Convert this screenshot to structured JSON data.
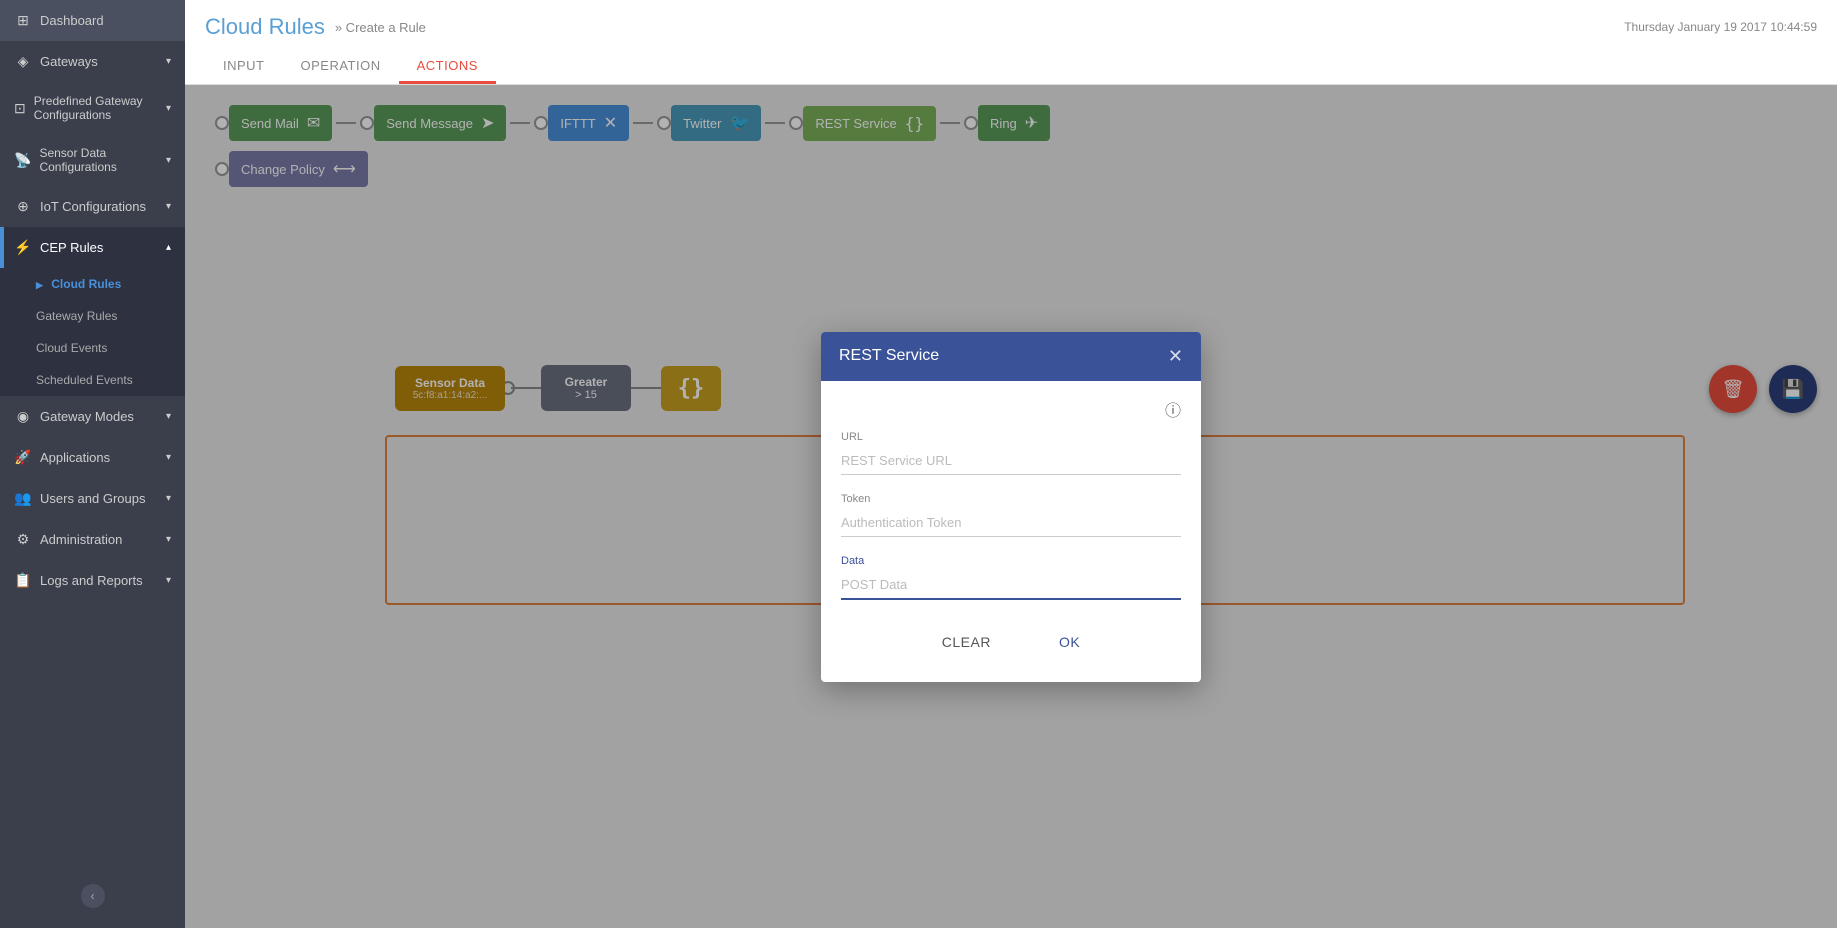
{
  "sidebar": {
    "items": [
      {
        "id": "dashboard",
        "label": "Dashboard",
        "icon": "⊞",
        "hasChevron": false,
        "active": false
      },
      {
        "id": "gateways",
        "label": "Gateways",
        "icon": "◈",
        "hasChevron": true,
        "active": false
      },
      {
        "id": "predefined-gateway",
        "label": "Predefined Gateway Configurations",
        "icon": "⊡",
        "hasChevron": true,
        "active": false
      },
      {
        "id": "sensor-data",
        "label": "Sensor Data Configurations",
        "icon": "📡",
        "hasChevron": true,
        "active": false
      },
      {
        "id": "iot-configurations",
        "label": "IoT Configurations",
        "icon": "⊕",
        "hasChevron": true,
        "active": false
      },
      {
        "id": "cep-rules",
        "label": "CEP Rules",
        "icon": "⚡",
        "hasChevron": true,
        "active": true
      },
      {
        "id": "gateway-modes",
        "label": "Gateway Modes",
        "icon": "◉",
        "hasChevron": true,
        "active": false
      },
      {
        "id": "applications",
        "label": "Applications",
        "icon": "🚀",
        "hasChevron": true,
        "active": false
      },
      {
        "id": "users-and-groups",
        "label": "Users and Groups",
        "icon": "👥",
        "hasChevron": true,
        "active": false
      },
      {
        "id": "administration",
        "label": "Administration",
        "icon": "⚙",
        "hasChevron": true,
        "active": false
      },
      {
        "id": "logs-and-reports",
        "label": "Logs and Reports",
        "icon": "📋",
        "hasChevron": true,
        "active": false
      }
    ],
    "subItems": [
      {
        "label": "Cloud Rules",
        "active": true
      },
      {
        "label": "Gateway Rules",
        "active": false
      },
      {
        "label": "Cloud Events",
        "active": false
      },
      {
        "label": "Scheduled Events",
        "active": false
      }
    ]
  },
  "header": {
    "title": "Cloud Rules",
    "breadcrumb": "» Create a Rule",
    "timestamp": "Thursday January 19 2017 10:44:59"
  },
  "tabs": [
    {
      "id": "input",
      "label": "INPUT",
      "active": false
    },
    {
      "id": "operation",
      "label": "OPERATION",
      "active": false
    },
    {
      "id": "actions",
      "label": "ACTIONS",
      "active": true
    }
  ],
  "actionNodes": [
    {
      "id": "send-mail",
      "label": "Send Mail",
      "icon": "✉",
      "colorClass": "node-send-mail"
    },
    {
      "id": "send-message",
      "label": "Send Message",
      "icon": "➤",
      "colorClass": "node-send-message"
    },
    {
      "id": "ifttt",
      "label": "IFTTT",
      "icon": "✕",
      "colorClass": "node-ifttt"
    },
    {
      "id": "twitter",
      "label": "Twitter",
      "icon": "🐦",
      "colorClass": "node-twitter"
    },
    {
      "id": "rest-service",
      "label": "REST Service",
      "icon": "{}",
      "colorClass": "node-rest-service"
    },
    {
      "id": "ring",
      "label": "Ring",
      "icon": "✈",
      "colorClass": "node-ring"
    },
    {
      "id": "change-policy",
      "label": "Change Policy",
      "icon": "⟷",
      "colorClass": "change-policy-node"
    }
  ],
  "flowNodes": {
    "sensor": {
      "label": "Sensor Data",
      "sublabel": "5c:f8:a1:14:a2:..."
    },
    "operator": {
      "label": "Greater",
      "sublabel": "> 15"
    },
    "action": {
      "icon": "{}",
      "label": ""
    }
  },
  "dialog": {
    "title": "REST Service",
    "fields": [
      {
        "id": "url",
        "label": "URL",
        "placeholder": "REST Service URL",
        "value": ""
      },
      {
        "id": "token",
        "label": "Token",
        "placeholder": "Authentication Token",
        "value": ""
      },
      {
        "id": "data",
        "label": "Data",
        "placeholder": "POST Data",
        "value": "",
        "active": true
      }
    ],
    "buttons": {
      "clear": "CLEAR",
      "ok": "OK"
    }
  }
}
